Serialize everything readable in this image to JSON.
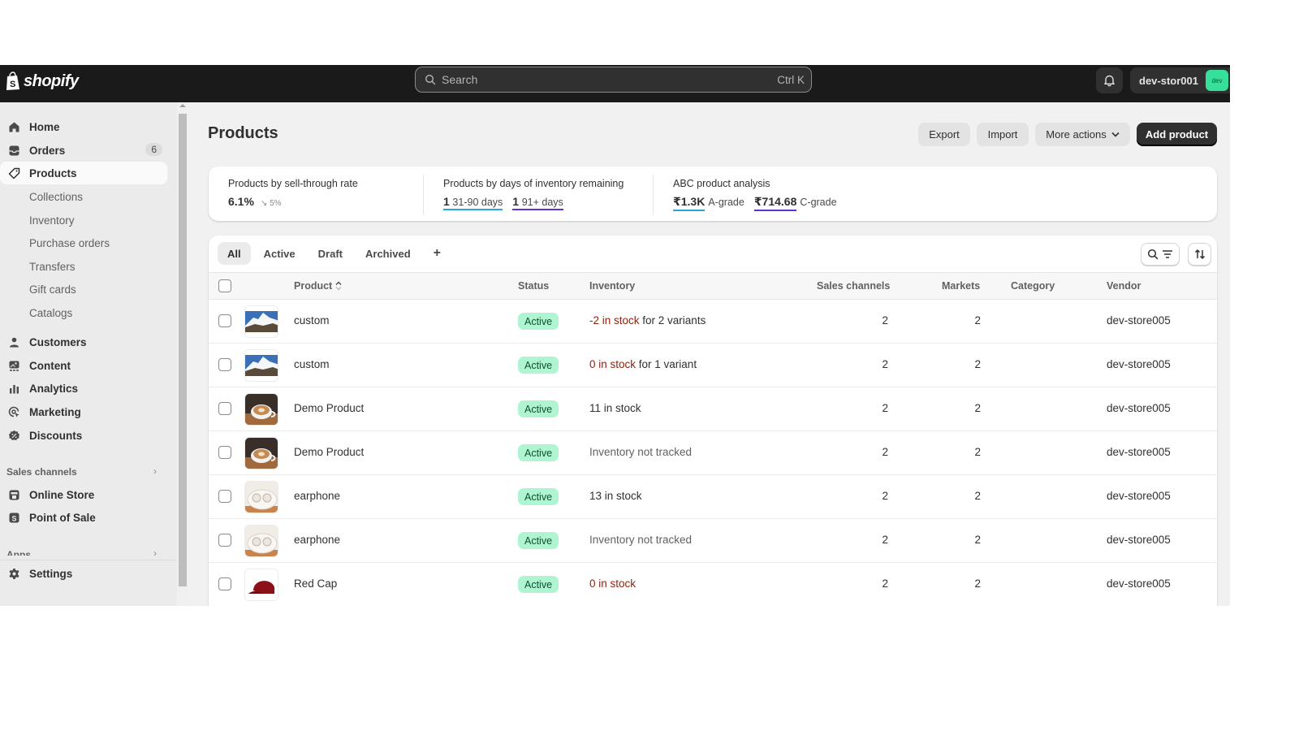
{
  "topbar": {
    "logo_text": "shopify",
    "search_placeholder": "Search",
    "search_shortcut": "Ctrl K",
    "store_name": "dev-stor001",
    "avatar_text": "dev"
  },
  "sidebar": {
    "items": [
      {
        "label": "Home",
        "icon": "home-icon"
      },
      {
        "label": "Orders",
        "icon": "orders-icon",
        "badge": "6"
      },
      {
        "label": "Products",
        "icon": "tag-icon",
        "active": true
      },
      {
        "label": "Collections",
        "sub": true
      },
      {
        "label": "Inventory",
        "sub": true
      },
      {
        "label": "Purchase orders",
        "sub": true
      },
      {
        "label": "Transfers",
        "sub": true
      },
      {
        "label": "Gift cards",
        "sub": true
      },
      {
        "label": "Catalogs",
        "sub": true
      },
      {
        "label": "Customers",
        "icon": "person-icon"
      },
      {
        "label": "Content",
        "icon": "content-icon"
      },
      {
        "label": "Analytics",
        "icon": "bar-chart-icon"
      },
      {
        "label": "Marketing",
        "icon": "target-icon"
      },
      {
        "label": "Discounts",
        "icon": "discount-icon"
      }
    ],
    "sales_channels_label": "Sales channels",
    "channels": [
      {
        "label": "Online Store",
        "icon": "store-icon"
      },
      {
        "label": "Point of Sale",
        "icon": "pos-icon"
      }
    ],
    "apps_label": "Apps",
    "settings_label": "Settings"
  },
  "page": {
    "title": "Products",
    "actions": {
      "export": "Export",
      "import": "Import",
      "more_actions": "More actions",
      "add_product": "Add product"
    }
  },
  "analytics": {
    "sell_through": {
      "title": "Products by sell-through rate",
      "value": "6.1%",
      "trend": "↘ 5%"
    },
    "days_inventory": {
      "title": "Products by days of inventory remaining",
      "groups": [
        {
          "count": "1",
          "label": "31-90 days"
        },
        {
          "count": "1",
          "label": "91+ days"
        }
      ]
    },
    "abc": {
      "title": "ABC product analysis",
      "groups": [
        {
          "value": "₹1.3K",
          "label": "A-grade"
        },
        {
          "value": "₹714.68",
          "label": "C-grade"
        }
      ]
    }
  },
  "tabs": [
    "All",
    "Active",
    "Draft",
    "Archived"
  ],
  "tab_add": "+",
  "table": {
    "columns": {
      "product": "Product",
      "status": "Status",
      "inventory": "Inventory",
      "sales_channels": "Sales channels",
      "markets": "Markets",
      "category": "Category",
      "vendor": "Vendor"
    },
    "rows": [
      {
        "name": "custom",
        "image": "mountain",
        "status": "Active",
        "inv_main": "-2 in stock",
        "inv_rest": " for 2 variants",
        "inv_tone": "red",
        "channels": "2",
        "markets": "2",
        "category": "",
        "vendor": "dev-store005"
      },
      {
        "name": "custom",
        "image": "mountain",
        "status": "Active",
        "inv_main": "0 in stock",
        "inv_rest": " for 1 variant",
        "inv_tone": "red",
        "channels": "2",
        "markets": "2",
        "category": "",
        "vendor": "dev-store005"
      },
      {
        "name": "Demo Product",
        "image": "coffee",
        "status": "Active",
        "inv_main": "11 in stock",
        "inv_rest": "",
        "inv_tone": "normal",
        "channels": "2",
        "markets": "2",
        "category": "",
        "vendor": "dev-store005"
      },
      {
        "name": "Demo Product",
        "image": "coffee",
        "status": "Active",
        "inv_main": "Inventory not tracked",
        "inv_rest": "",
        "inv_tone": "muted",
        "channels": "2",
        "markets": "2",
        "category": "",
        "vendor": "dev-store005"
      },
      {
        "name": "earphone",
        "image": "earbuds",
        "status": "Active",
        "inv_main": "13 in stock",
        "inv_rest": "",
        "inv_tone": "normal",
        "channels": "2",
        "markets": "2",
        "category": "",
        "vendor": "dev-store005"
      },
      {
        "name": "earphone",
        "image": "earbuds",
        "status": "Active",
        "inv_main": "Inventory not tracked",
        "inv_rest": "",
        "inv_tone": "muted",
        "channels": "2",
        "markets": "2",
        "category": "",
        "vendor": "dev-store005"
      },
      {
        "name": "Red Cap",
        "image": "cap",
        "status": "Active",
        "inv_main": "0 in stock",
        "inv_rest": "",
        "inv_tone": "red",
        "channels": "2",
        "markets": "2",
        "category": "",
        "vendor": "dev-store005"
      }
    ]
  }
}
